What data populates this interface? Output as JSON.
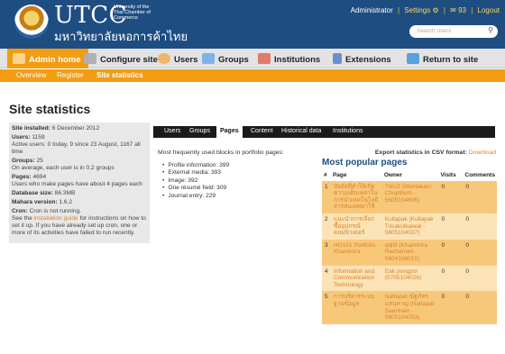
{
  "header": {
    "brand": "UTCC",
    "brand_sub": "University of the Thai Chamber of Commerce",
    "brand_thai": "มหาวิทยาลัยหอการค้าไทย",
    "user": "Administrator",
    "settings": "Settings",
    "messages": "93",
    "logout": "Logout",
    "search_placeholder": "Search users"
  },
  "nav": {
    "items": [
      "Admin home",
      "Configure site",
      "Users",
      "Groups",
      "Institutions",
      "Extensions",
      "Return to site"
    ],
    "active": "Admin home",
    "sub": [
      "Overview",
      "Register",
      "Site statistics"
    ],
    "sub_active": "Site statistics"
  },
  "page": {
    "title": "Site statistics"
  },
  "sidebar": {
    "installed_label": "Site installed:",
    "installed_value": "6 December 2012",
    "users_label": "Users:",
    "users_value": "1159",
    "users_desc": "Active users: 0 today, 9 since 23 August, 1167 all time",
    "groups_label": "Groups:",
    "groups_value": "25",
    "groups_desc": "On average, each user is in 0.2 groups",
    "pages_label": "Pages:",
    "pages_value": "4694",
    "pages_desc": "Users who make pages have about 4 pages each",
    "db_label": "Database size:",
    "db_value": "86.3MB",
    "version_label": "Mahara version:",
    "version_value": "1.6.2",
    "cron_label": "Cron:",
    "cron_value": "Cron is not running.",
    "cron_pre": "See the",
    "cron_link": "installation guide",
    "cron_post": "for instructions on how to set it up. If you have already set up cron, one or more of its activities have failed to run recently."
  },
  "tabs": {
    "items": [
      "Users",
      "Groups",
      "Pages",
      "Content",
      "Historical data",
      "Institutions"
    ],
    "active": "Pages"
  },
  "blocks": {
    "title": "Most frequently used blocks in portfolio pages:",
    "items": [
      "Profile information: 399",
      "External media: 393",
      "Image: 392",
      "One résumé field: 309",
      "Journal entry: 229"
    ]
  },
  "export": {
    "label": "Export statistics in CSV format:",
    "link": "Download"
  },
  "popular": {
    "title": "Most popular pages",
    "headers": [
      "#",
      "Page",
      "Owner",
      "Visits",
      "Comments"
    ],
    "rows": [
      {
        "n": "1",
        "page": "ปัจจัยที่ทำให้เกิดความเต็มเพลาในการนำเทคโนโลยีสารสนเทศมาใช้",
        "owner": "TitlizZ (Montakarn Chopthum - 5605104606)",
        "visits": "0",
        "comments": "0"
      },
      {
        "n": "2",
        "page": "แนะนำการเลือกซื้ออุปกรณ์คอมพิวเตอร์",
        "owner": "Kullapak (Kullapak Trisakulkaiwal - 5605104037)",
        "visits": "0",
        "comments": "0"
      },
      {
        "n": "3",
        "page": "HO101 Portfolio - Khamintra",
        "owner": "qqll9 (Khamintra Rachamart - 5604108010)",
        "visits": "0",
        "comments": "0"
      },
      {
        "n": "4",
        "page": "Information and Communication Technology",
        "owner": "Eak pongpol (5705104026)",
        "visits": "0",
        "comments": "0"
      },
      {
        "n": "5",
        "page": "การบริหารระบบฐานข้อมูล",
        "owner": "Nattapat ณัฐภัทร แสนหาญ (Nattapat Saenham - 5605104053)",
        "visits": "0",
        "comments": "0"
      }
    ]
  },
  "colors": {
    "header_bg": "#1e4d82",
    "accent": "#f39c12",
    "link": "#d9822b",
    "row_odd": "#f8c87a",
    "row_even": "#fbe3b6"
  }
}
